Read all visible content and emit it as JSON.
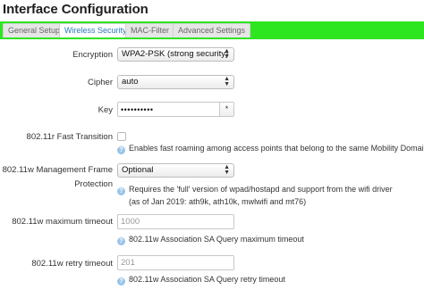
{
  "page": {
    "title": "Interface Configuration"
  },
  "tabs": [
    {
      "label": "General Setup"
    },
    {
      "label": "Wireless Security"
    },
    {
      "label": "MAC-Filter"
    },
    {
      "label": "Advanced Settings"
    }
  ],
  "encryption": {
    "label": "Encryption",
    "value": "WPA2-PSK (strong security)"
  },
  "cipher": {
    "label": "Cipher",
    "value": "auto"
  },
  "key": {
    "label": "Key",
    "value": "••••••••••",
    "reveal": "*"
  },
  "fast_transition": {
    "label": "802.11r Fast Transition",
    "checked": false,
    "help": "Enables fast roaming among access points that belong to the same Mobility Domain"
  },
  "mgmt_frame": {
    "label_line1": "802.11w Management Frame",
    "label_line2": "Protection",
    "value": "Optional",
    "help_line1": "Requires the 'full' version of wpad/hostapd and support from the wifi driver",
    "help_line2": "(as of Jan 2019: ath9k, ath10k, mwlwifi and mt76)"
  },
  "max_timeout": {
    "label": "802.11w maximum timeout",
    "placeholder": "1000",
    "help": "802.11w Association SA Query maximum timeout"
  },
  "retry_timeout": {
    "label": "802.11w retry timeout",
    "placeholder": "201",
    "help": "802.11w Association SA Query retry timeout"
  },
  "icons": {
    "help": "help-icon",
    "select": "select-arrows-icon"
  },
  "colors": {
    "tabbar": "#2ee620",
    "active_tab_text": "#2a7ab8",
    "help_icon": "#9ac4e8"
  }
}
